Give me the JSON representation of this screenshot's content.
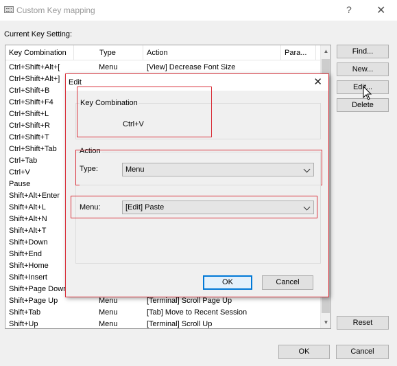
{
  "window": {
    "title": "Custom Key mapping",
    "help_icon": "?",
    "close_icon": "✕"
  },
  "current_key_label": "Current Key Setting:",
  "list": {
    "columns": [
      "Key Combination",
      "Type",
      "Action",
      "Para..."
    ],
    "rows": [
      {
        "key": "Ctrl+Shift+Alt+[",
        "type": "Menu",
        "action": "[View] Decrease Font Size"
      },
      {
        "key": "Ctrl+Shift+Alt+]",
        "type": "",
        "action": ""
      },
      {
        "key": "Ctrl+Shift+B",
        "type": "",
        "action": ""
      },
      {
        "key": "Ctrl+Shift+F4",
        "type": "",
        "action": ""
      },
      {
        "key": "Ctrl+Shift+L",
        "type": "",
        "action": ""
      },
      {
        "key": "Ctrl+Shift+R",
        "type": "",
        "action": ""
      },
      {
        "key": "Ctrl+Shift+T",
        "type": "",
        "action": ""
      },
      {
        "key": "Ctrl+Shift+Tab",
        "type": "",
        "action": ""
      },
      {
        "key": "Ctrl+Tab",
        "type": "",
        "action": ""
      },
      {
        "key": "Ctrl+V",
        "type": "",
        "action": ""
      },
      {
        "key": "Pause",
        "type": "",
        "action": ""
      },
      {
        "key": "Shift+Alt+Enter",
        "type": "",
        "action": ""
      },
      {
        "key": "Shift+Alt+L",
        "type": "",
        "action": ""
      },
      {
        "key": "Shift+Alt+N",
        "type": "",
        "action": ""
      },
      {
        "key": "Shift+Alt+T",
        "type": "",
        "action": ""
      },
      {
        "key": "Shift+Down",
        "type": "",
        "action": ""
      },
      {
        "key": "Shift+End",
        "type": "",
        "action": ""
      },
      {
        "key": "Shift+Home",
        "type": "",
        "action": ""
      },
      {
        "key": "Shift+Insert",
        "type": "",
        "action": ""
      },
      {
        "key": "Shift+Page Down",
        "type": "",
        "action": ""
      },
      {
        "key": "Shift+Page Up",
        "type": "Menu",
        "action": "[Terminal] Scroll Page Up"
      },
      {
        "key": "Shift+Tab",
        "type": "Menu",
        "action": "[Tab] Move to Recent Session"
      },
      {
        "key": "Shift+Up",
        "type": "Menu",
        "action": "[Terminal] Scroll Up"
      }
    ]
  },
  "side_buttons": {
    "find": "Find...",
    "new": "New...",
    "edit": "Edit...",
    "delete": "Delete",
    "reset": "Reset"
  },
  "footer": {
    "ok": "OK",
    "cancel": "Cancel"
  },
  "edit_dialog": {
    "title": "Edit",
    "close_icon": "✕",
    "key_group_label": "Key Combination",
    "key_value": "Ctrl+V",
    "action_group_label": "Action",
    "type_label": "Type:",
    "type_value": "Menu",
    "menu_label": "Menu:",
    "menu_value": "[Edit] Paste",
    "ok": "OK",
    "cancel": "Cancel"
  },
  "colors": {
    "highlight_border": "#d9303a",
    "default_button_border": "#0078d7"
  }
}
